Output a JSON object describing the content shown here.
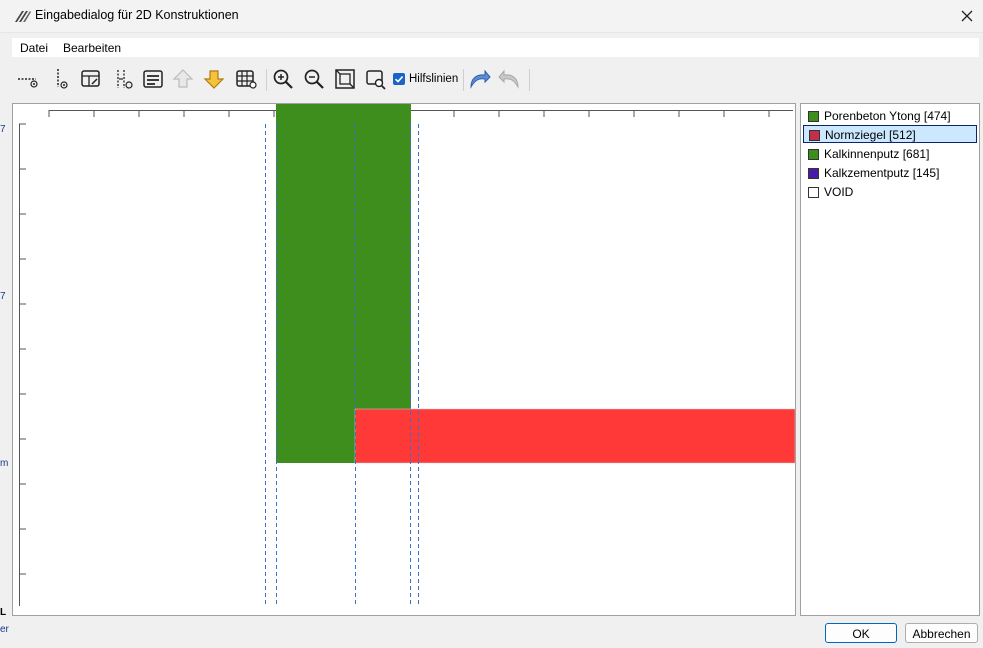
{
  "window": {
    "title": "Eingabedialog für 2D Konstruktionen",
    "close_glyph": "✕"
  },
  "menu": {
    "items": [
      "Datei",
      "Bearbeiten"
    ]
  },
  "toolbar": {
    "buttons": [
      "horizontal-line-icon",
      "vertical-line-icon",
      "edit-table-icon",
      "split-vertical-icon",
      "list-icon",
      "arrow-up-icon",
      "arrow-down-icon",
      "grid-icon",
      "zoom-in-icon",
      "zoom-out-icon",
      "zoom-fit-icon",
      "zoom-window-icon",
      "undo-icon",
      "redo-icon"
    ],
    "checkbox": {
      "label": "Hilfslinien",
      "checked": true
    }
  },
  "materials": [
    {
      "label": "Porenbeton Ytong [474]",
      "color": "#3e8e1e",
      "selected": false
    },
    {
      "label": "Normziegel [512]",
      "color": "#c0304a",
      "selected": true
    },
    {
      "label": "Kalkinnenputz [681]",
      "color": "#3e8e1e",
      "selected": false
    },
    {
      "label": "Kalkzementputz [145]",
      "color": "#4a1aa8",
      "selected": false
    },
    {
      "label": "VOID",
      "color": "#ffffff",
      "selected": false
    }
  ],
  "canvas": {
    "green_color": "#3e8e1e",
    "red_color": "#ff3333",
    "guide_color": "#3a6fd0"
  },
  "buttons": {
    "ok": "OK",
    "cancel": "Abbrechen"
  },
  "background_edge_text": [
    "7",
    "7",
    "m",
    "L",
    "er"
  ]
}
